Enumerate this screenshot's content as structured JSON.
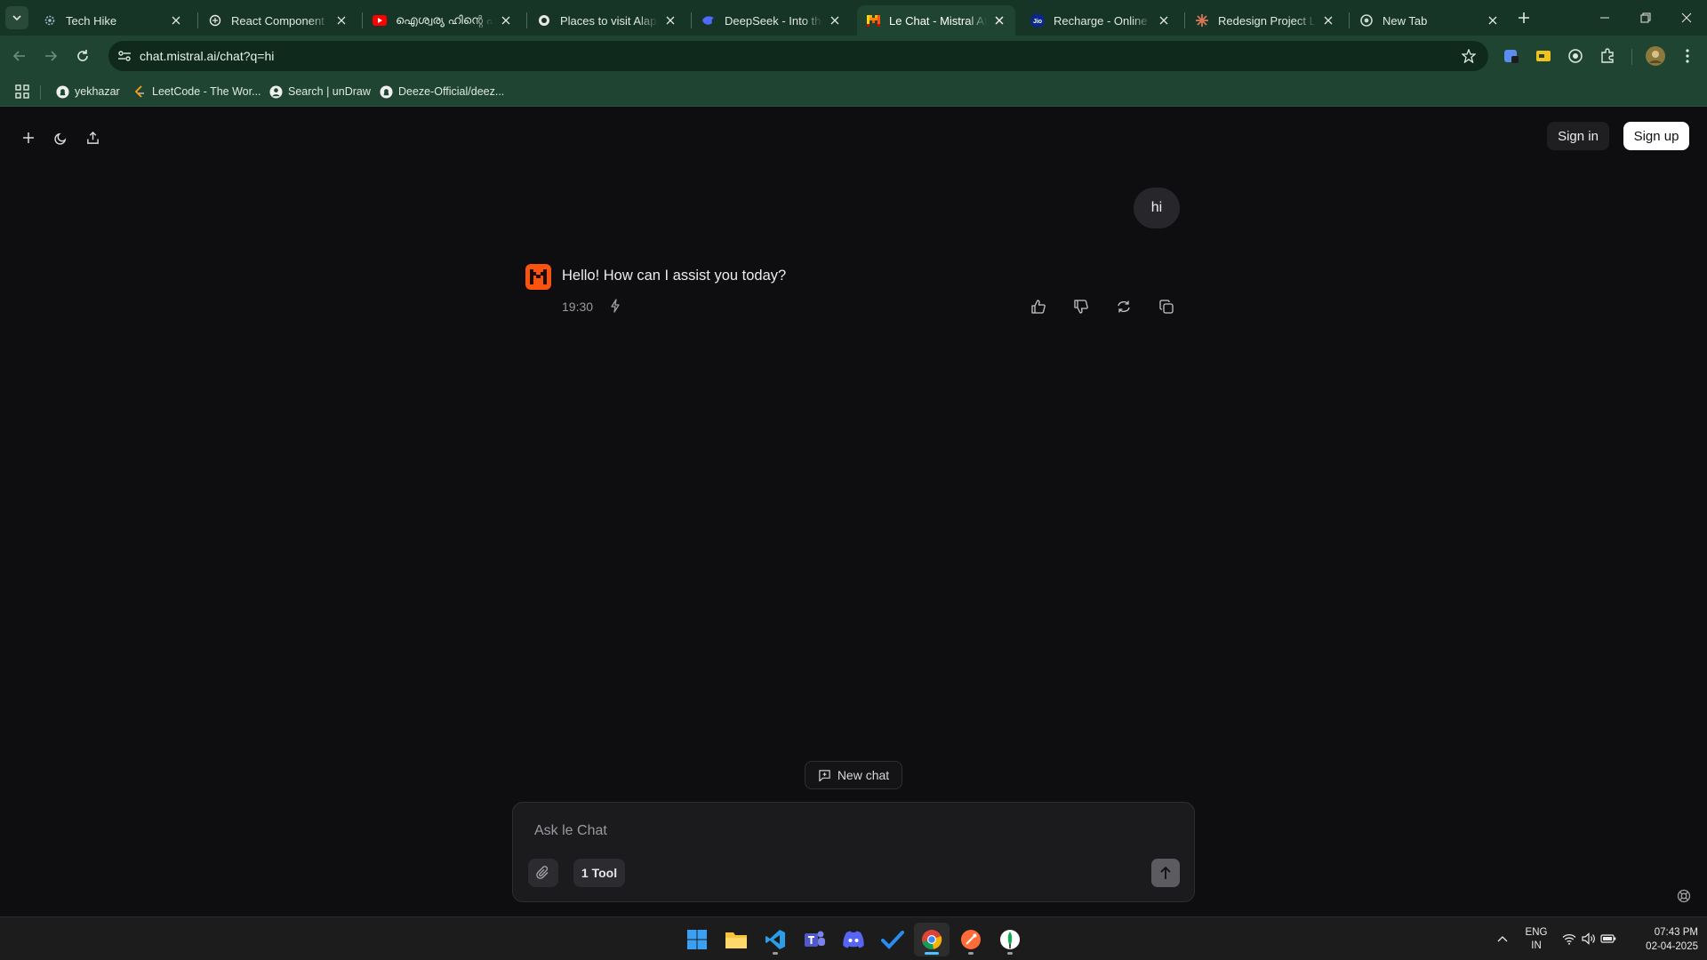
{
  "browser": {
    "tabs": [
      {
        "title": "Tech Hike",
        "icon": "settings-gear-icon",
        "active": false
      },
      {
        "title": "React Component for",
        "icon": "openai-icon",
        "active": false
      },
      {
        "title": "ഐശ്വര്യ ഹിന്റെ ഫ്",
        "icon": "youtube-icon",
        "active": false
      },
      {
        "title": "Places to visit Alappuzha",
        "icon": "chatgpt-icon",
        "active": false
      },
      {
        "title": "DeepSeek - Into the Unknown",
        "icon": "deepseek-icon",
        "active": false
      },
      {
        "title": "Le Chat - Mistral AI",
        "icon": "mistral-icon",
        "active": true
      },
      {
        "title": "Recharge - Online Recharge",
        "icon": "jio-icon",
        "active": false
      },
      {
        "title": "Redesign Project Layout",
        "icon": "claude-icon",
        "active": false
      },
      {
        "title": "New Tab",
        "icon": "chrome-icon",
        "active": false
      }
    ],
    "url": "chat.mistral.ai/chat?q=hi",
    "bookmarks": [
      {
        "label": "yekhazar",
        "icon": "github-icon"
      },
      {
        "label": "LeetCode - The Wor...",
        "icon": "leetcode-icon"
      },
      {
        "label": "Search | unDraw",
        "icon": "undraw-icon"
      },
      {
        "label": "Deeze-Official/deez...",
        "icon": "github-icon"
      }
    ]
  },
  "page": {
    "sign_in": "Sign in",
    "sign_up": "Sign up",
    "user_message": "hi",
    "assistant_message": "Hello! How can I assist you today?",
    "assistant_time": "19:30",
    "new_chat": "New chat",
    "composer_placeholder": "Ask le Chat",
    "tool_button": "1 Tool",
    "accent_color": "#fa520f"
  },
  "taskbar": {
    "apps": [
      "windows-start-icon",
      "file-explorer-icon",
      "vscode-icon",
      "teams-icon",
      "discord-icon",
      "todo-icon",
      "chrome-icon",
      "postman-icon",
      "mongodb-compass-icon"
    ],
    "lang_top": "ENG",
    "lang_bottom": "IN",
    "time": "07:43 PM",
    "date": "02-04-2025"
  }
}
